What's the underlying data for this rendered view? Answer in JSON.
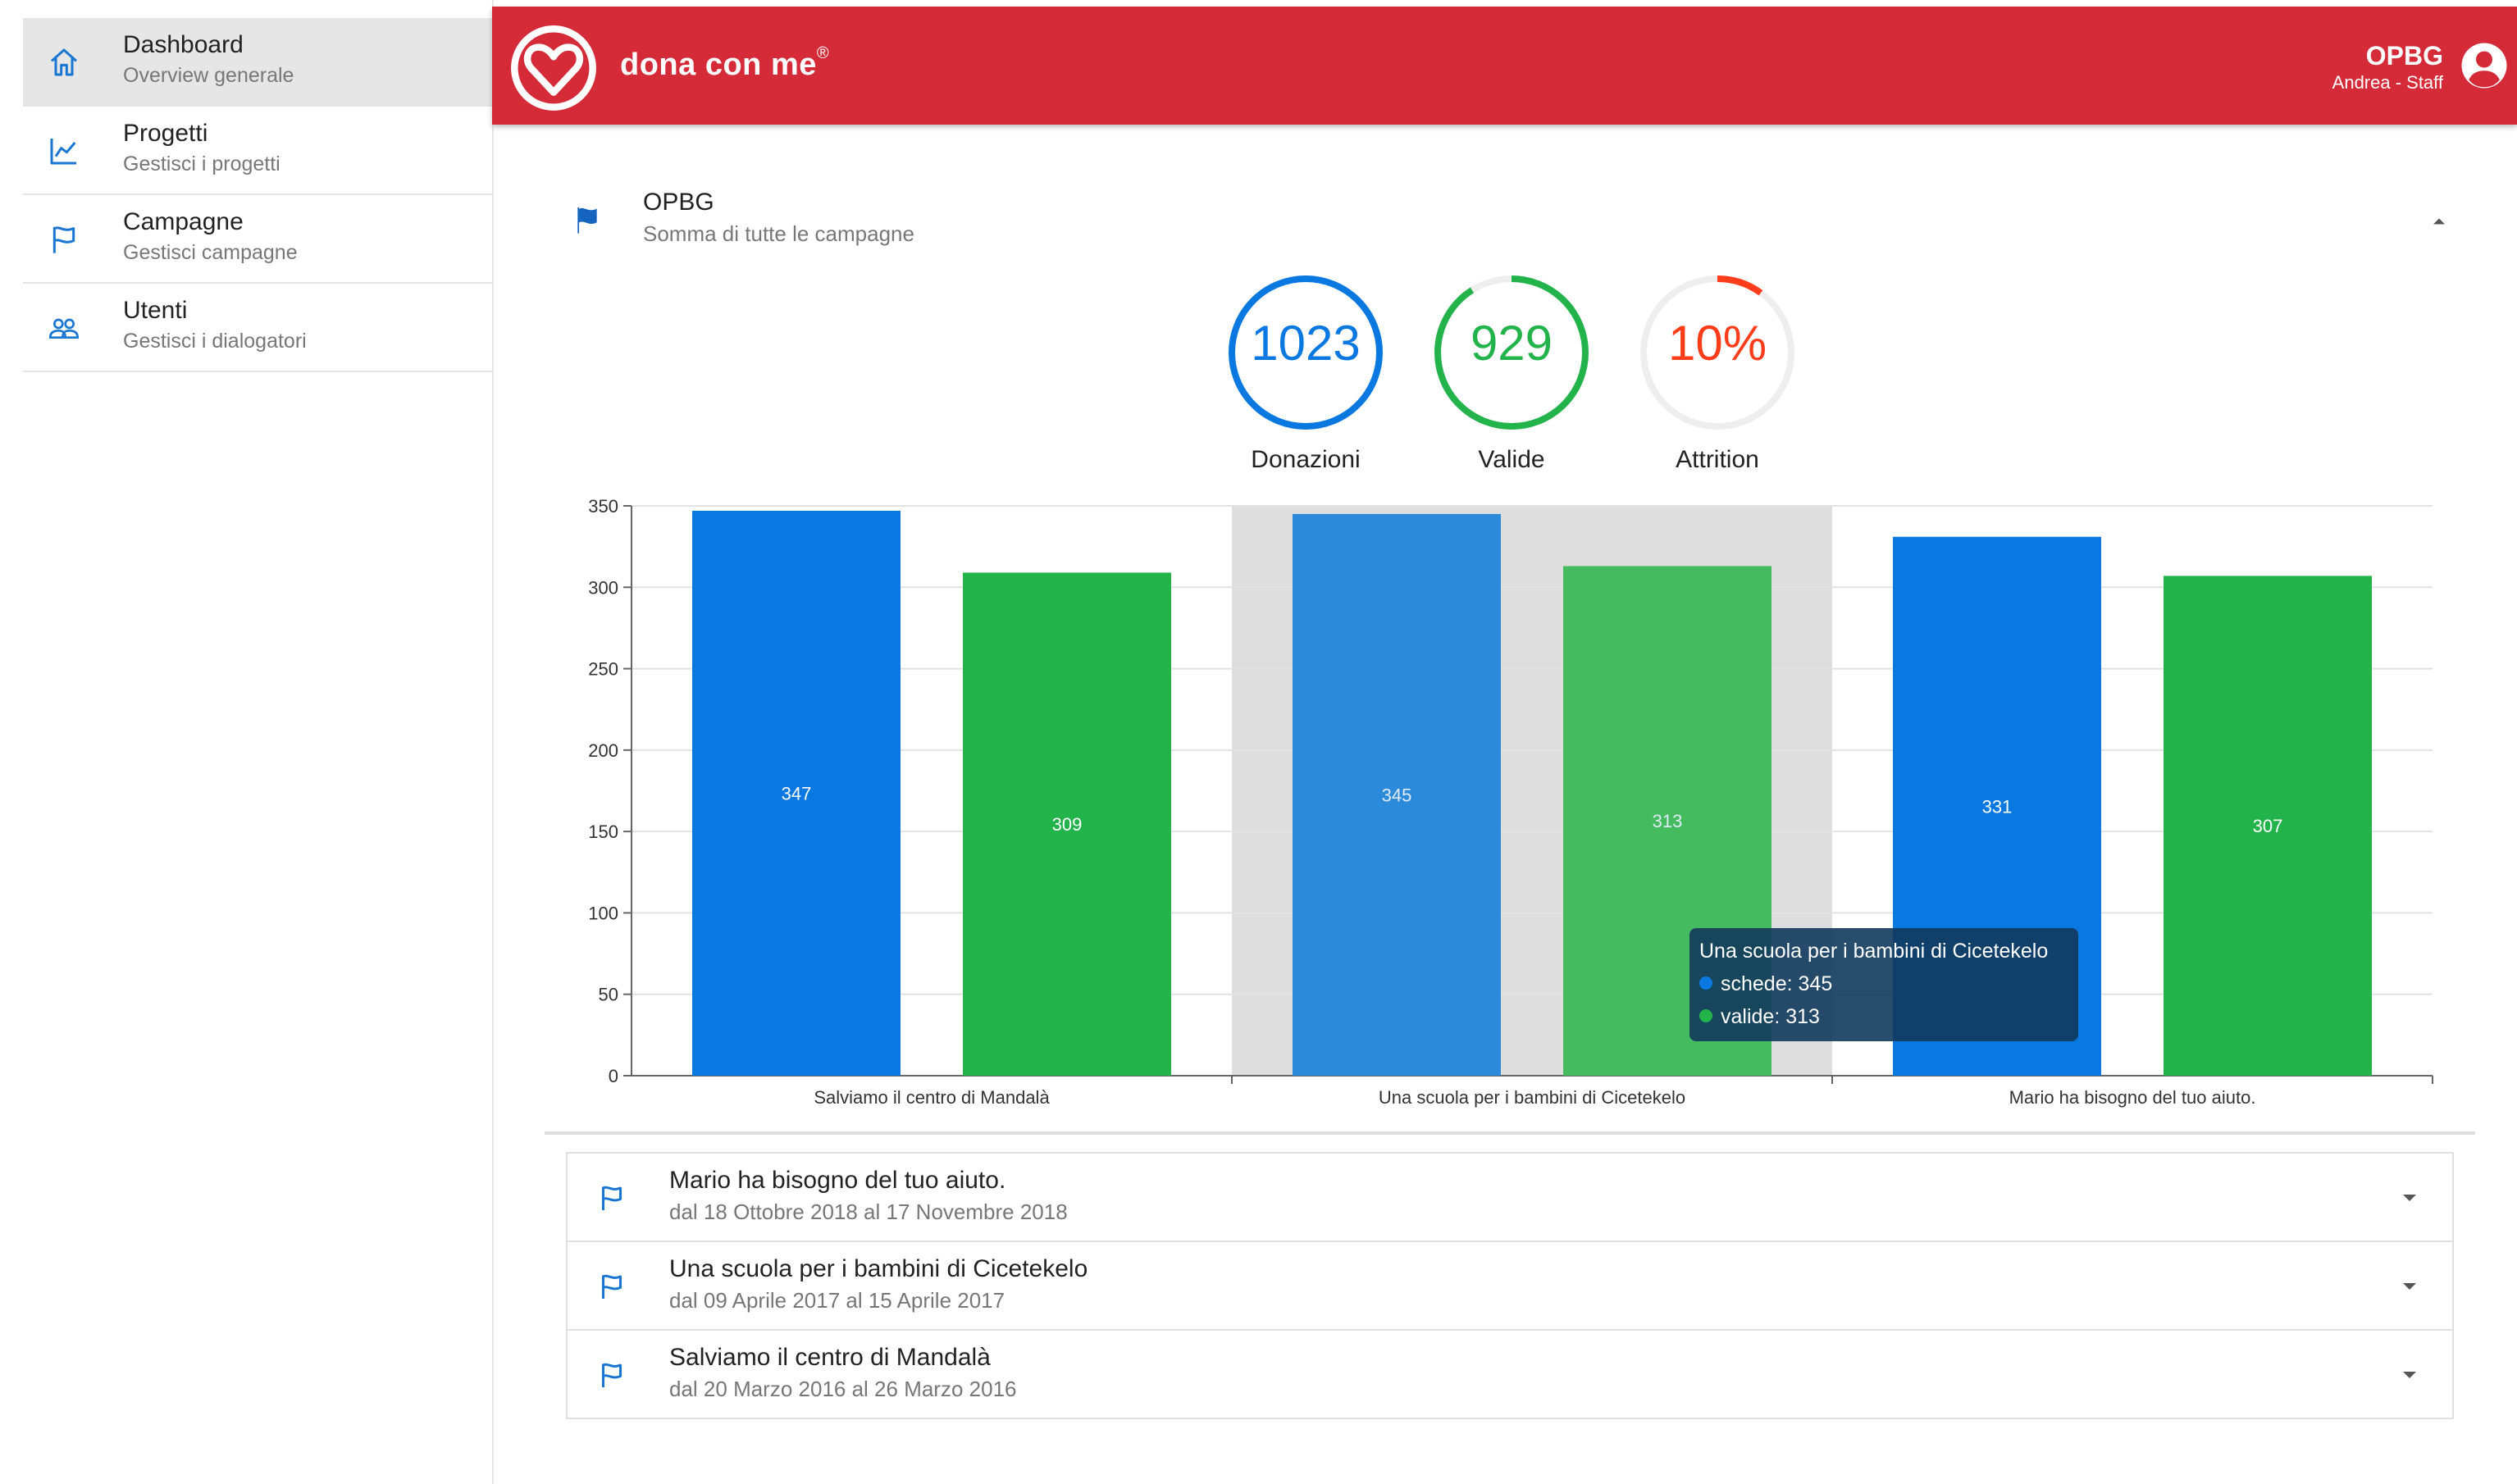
{
  "sidebar": {
    "items": [
      {
        "label": "Dashboard",
        "sublabel": "Overview generale",
        "icon": "home-icon",
        "active": true
      },
      {
        "label": "Progetti",
        "sublabel": "Gestisci i progetti",
        "icon": "chart-line-icon",
        "active": false
      },
      {
        "label": "Campagne",
        "sublabel": "Gestisci campagne",
        "icon": "flag-outline-icon",
        "active": false
      },
      {
        "label": "Utenti",
        "sublabel": "Gestisci i dialogatori",
        "icon": "users-icon",
        "active": false
      }
    ]
  },
  "header": {
    "brand": "dona con me",
    "brand_mark": "®",
    "org": "OPBG",
    "user": "Andrea - Staff",
    "color": "#d52a37"
  },
  "summary": {
    "title": "OPBG",
    "subtitle": "Somma di tutte le campagne",
    "stats": [
      {
        "value": "1023",
        "label": "Donazioni",
        "color": "#0a78e1",
        "fraction": 1.0
      },
      {
        "value": "929",
        "label": "Valide",
        "color": "#22b44a",
        "fraction": 0.91
      },
      {
        "value": "10%",
        "label": "Attrition",
        "color": "#ff3d1a",
        "fraction": 0.1
      }
    ]
  },
  "chart_data": {
    "type": "bar",
    "categories": [
      "Salviamo il centro di Mandalà",
      "Una scuola per i bambini di Cicetekelo",
      "Mario ha bisogno del tuo aiuto."
    ],
    "series": [
      {
        "name": "schede",
        "values": [
          347,
          345,
          331
        ],
        "color": "#0a78e1"
      },
      {
        "name": "valide",
        "values": [
          309,
          313,
          307
        ],
        "color": "#22b44a"
      }
    ],
    "ylim": [
      0,
      350
    ],
    "yticks": [
      0,
      50,
      100,
      150,
      200,
      250,
      300,
      350
    ],
    "grid": true,
    "highlighted_category": 1,
    "tooltip": {
      "title": "Una scuola per i bambini di Cicetekelo",
      "rows": [
        "schede: 345",
        "valide: 313"
      ]
    }
  },
  "campaigns": [
    {
      "title": "Mario ha bisogno del tuo aiuto.",
      "dates": "dal 18 Ottobre 2018 al 17 Novembre 2018"
    },
    {
      "title": "Una scuola per i bambini di Cicetekelo",
      "dates": "dal 09 Aprile 2017 al 15 Aprile 2017"
    },
    {
      "title": "Salviamo il centro di Mandalà",
      "dates": "dal 20 Marzo 2016 al 26 Marzo 2016"
    }
  ]
}
